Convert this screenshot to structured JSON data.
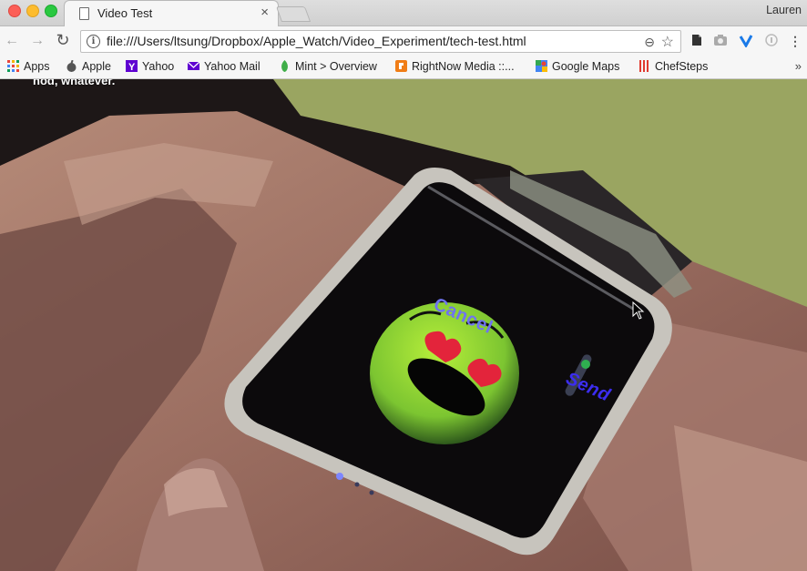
{
  "window": {
    "tab_title": "Video Test",
    "tab_close": "×",
    "profile_name": "Lauren"
  },
  "toolbar": {
    "back_icon": "←",
    "forward_icon": "→",
    "reload_icon": "↻",
    "url": "file:///Users/ltsung/Dropbox/Apple_Watch/Video_Experiment/tech-test.html",
    "info_icon": "i",
    "zoom_icon": "⊖",
    "bookmark_star_icon": "☆",
    "menu_icon": "⋮"
  },
  "bookmarks": [
    {
      "label": "Apps",
      "icon": "apps-grid-icon",
      "color": "#e8453c"
    },
    {
      "label": "Apple",
      "icon": "apple-icon",
      "color": "#555555"
    },
    {
      "label": "Yahoo",
      "icon": "yahoo-icon",
      "color": "#5f01d1"
    },
    {
      "label": "Yahoo Mail",
      "icon": "mail-envelope-icon",
      "color": "#5f01d1"
    },
    {
      "label": "Mint > Overview",
      "icon": "mint-leaf-icon",
      "color": "#3fae49"
    },
    {
      "label": "RightNow Media ::...",
      "icon": "rightnow-icon",
      "color": "#f07d16"
    },
    {
      "label": "Google Maps",
      "icon": "maps-pin-icon",
      "color": "#34a853"
    },
    {
      "label": "ChefSteps",
      "icon": "chefsteps-icon",
      "color": "#e03a2f"
    }
  ],
  "bookmarks_overflow": "»",
  "page": {
    "caption": "nod, whatever.",
    "watch_cancel": "Cancel",
    "watch_send": "Send"
  },
  "colors": {
    "background_green": "#9aa561",
    "emoji_green": "#8ed43a",
    "watch_blue": "#6f74f0"
  }
}
